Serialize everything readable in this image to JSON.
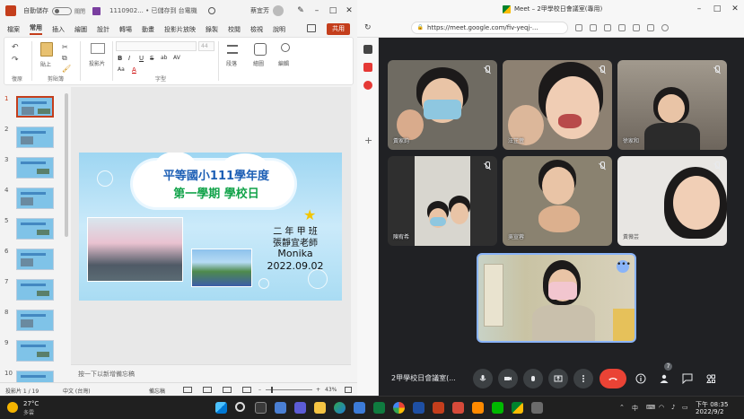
{
  "ppt": {
    "autosave_label": "自動儲存",
    "toggle_state": "關閉",
    "file_name": "1110902... • 已儲存到 台電機",
    "user_name": "蔡宜芳",
    "tabs": [
      "檔案",
      "常用",
      "插入",
      "繪圖",
      "設計",
      "轉場",
      "動畫",
      "投影片放映",
      "錄製",
      "校閱",
      "檢視",
      "說明"
    ],
    "active_tab": 1,
    "share_label": "共用",
    "font_size_placeholder": "44",
    "ribbon": {
      "paste": "貼上",
      "new_slide": "投影片",
      "paragraph": "段落",
      "drawing": "繪圖",
      "editing": "編輯",
      "group_undo": "復原",
      "group_clipboard": "剪貼簿",
      "group_font": "字型",
      "format_buttons": [
        "B",
        "I",
        "U",
        "S",
        "ab",
        "AV",
        "Aa",
        "A"
      ]
    },
    "thumbnails": [
      "1",
      "2",
      "3",
      "4",
      "5",
      "6",
      "7",
      "8",
      "9",
      "10"
    ],
    "active_thumbnail": 0,
    "slide": {
      "title_line1": "平等國小111學年度",
      "title_line2": "第一學期 學校日",
      "class": "二 年 甲 班",
      "teacher": "張靜宜老師",
      "name": "Monika",
      "date": "2022.09.02"
    },
    "notes_placeholder": "按一下以新增備忘稿",
    "status": {
      "slide_counter": "投影片 1 / 19",
      "language": "中文 (台灣)",
      "notes_label": "備忘稿",
      "zoom": "43%"
    }
  },
  "meet": {
    "tab_title": "Meet – 2甲學校日會議室(專用)",
    "url": "https://meet.google.com/fiv-yeqj-...",
    "participants": [
      {
        "name": "黃家鈞"
      },
      {
        "name": "汪芷萱"
      },
      {
        "name": "徐家和"
      },
      {
        "name": "陳宥希"
      },
      {
        "name": "吳宣蓉"
      },
      {
        "name": "黃薇芸"
      }
    ],
    "self_more_label": "•••",
    "meeting_name": "2甲學校日會議室(...",
    "participant_count": "7"
  },
  "taskbar": {
    "temperature": "27°C",
    "condition": "多雲",
    "time": "下午 08:35",
    "date": "2022/9/2",
    "lang_indicator": "中"
  },
  "colors": {
    "ppt_accent": "#c43e1c",
    "meet_bg": "#202124",
    "hangup_red": "#ea4335",
    "self_border": "#8ab4f8"
  }
}
